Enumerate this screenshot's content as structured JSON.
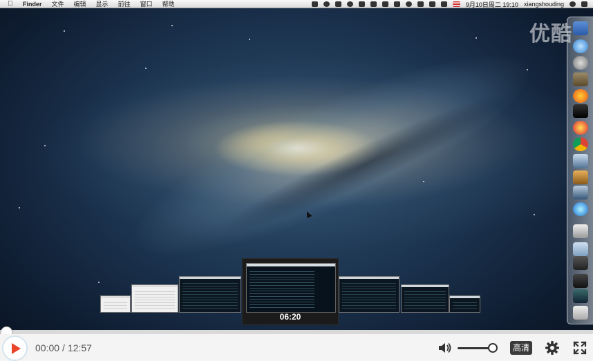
{
  "menubar": {
    "app_name": "Finder",
    "menus": [
      "文件",
      "编辑",
      "显示",
      "前往",
      "窗口",
      "帮助"
    ],
    "clock": "9月10日周二  19:10",
    "user": "xiangshouding"
  },
  "watermark": "优酷",
  "preview": {
    "time": "06:20"
  },
  "player": {
    "current_time": "00:00",
    "separator": "/",
    "duration": "12:57",
    "progress": 0.0,
    "volume": 0.9,
    "quality_label": "高清"
  },
  "colors": {
    "accent": "#f05a28",
    "play_icon": "#e8452a"
  },
  "icons": {
    "play": "play-icon",
    "volume": "volume-icon",
    "settings": "gear-icon",
    "fullscreen": "fullscreen-icon"
  }
}
